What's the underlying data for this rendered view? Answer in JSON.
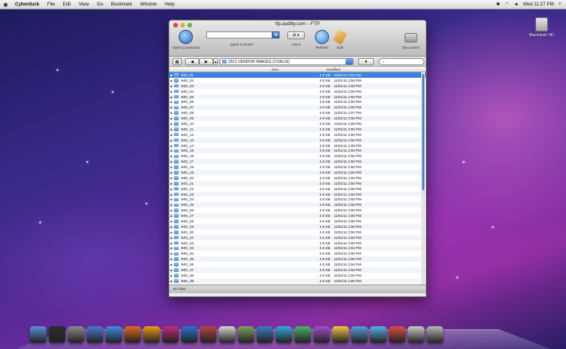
{
  "menubar": {
    "apple": "",
    "app_name": "Cyberduck",
    "items": [
      "File",
      "Edit",
      "View",
      "Go",
      "Bookmark",
      "Window",
      "Help"
    ],
    "clock": "Wed 11:27 PM"
  },
  "desktop": {
    "drive_label": "Macintosh HD"
  },
  "window": {
    "title": "ftp.auditly.com – FTP",
    "toolbar": {
      "open_connection": "Open Connection",
      "quick_connect": "Quick Connect",
      "action": "Action",
      "refresh": "Refresh",
      "edit": "Edit",
      "disconnect": "Disconnect"
    },
    "path": "2012 VENDOR IMAGES (COALIS)",
    "search_placeholder": "",
    "columns": {
      "size": "Size",
      "modified": "Modified"
    },
    "status": "51 Files"
  },
  "files": [
    {
      "name": "IMG_01",
      "size": "4.0 KB",
      "modified": "11/01/11 9:03 AM",
      "selected": true
    },
    {
      "name": "IMG_02",
      "size": "4.0 KB",
      "modified": "11/01/11 2:50 PM"
    },
    {
      "name": "IMG_03",
      "size": "4.0 KB",
      "modified": "11/01/11 2:50 PM"
    },
    {
      "name": "IMG_04",
      "size": "4.0 KB",
      "modified": "11/01/11 2:50 PM"
    },
    {
      "name": "IMG_05",
      "size": "4.0 KB",
      "modified": "11/01/11 2:50 PM"
    },
    {
      "name": "IMG_06",
      "size": "4.0 KB",
      "modified": "11/01/11 2:50 PM"
    },
    {
      "name": "IMG_07",
      "size": "4.0 KB",
      "modified": "11/01/11 2:50 PM"
    },
    {
      "name": "IMG_08",
      "size": "4.0 KB",
      "modified": "11/01/11 4:07 PM"
    },
    {
      "name": "IMG_09",
      "size": "4.0 KB",
      "modified": "11/01/11 2:50 PM"
    },
    {
      "name": "IMG_10",
      "size": "4.0 KB",
      "modified": "11/01/11 2:50 PM"
    },
    {
      "name": "IMG_11",
      "size": "4.0 KB",
      "modified": "11/01/11 2:50 PM"
    },
    {
      "name": "IMG_12",
      "size": "4.0 KB",
      "modified": "11/01/11 2:50 PM"
    },
    {
      "name": "IMG_13",
      "size": "4.0 KB",
      "modified": "11/01/11 2:50 PM"
    },
    {
      "name": "IMG_14",
      "size": "4.0 KB",
      "modified": "11/01/11 2:50 PM"
    },
    {
      "name": "IMG_15",
      "size": "4.0 KB",
      "modified": "11/01/11 2:50 PM"
    },
    {
      "name": "IMG_16",
      "size": "4.0 KB",
      "modified": "11/01/11 2:50 PM"
    },
    {
      "name": "IMG_17",
      "size": "4.0 KB",
      "modified": "11/01/11 2:50 PM"
    },
    {
      "name": "IMG_18",
      "size": "4.0 KB",
      "modified": "11/01/11 2:50 PM"
    },
    {
      "name": "IMG_19",
      "size": "4.0 KB",
      "modified": "11/01/11 2:50 PM"
    },
    {
      "name": "IMG_20",
      "size": "4.0 KB",
      "modified": "11/01/11 2:50 PM"
    },
    {
      "name": "IMG_21",
      "size": "4.0 KB",
      "modified": "11/01/11 2:50 PM"
    },
    {
      "name": "IMG_22",
      "size": "4.0 KB",
      "modified": "11/01/11 2:50 PM"
    },
    {
      "name": "IMG_23",
      "size": "4.0 KB",
      "modified": "11/01/11 2:50 PM"
    },
    {
      "name": "IMG_24",
      "size": "4.0 KB",
      "modified": "11/01/11 2:50 PM"
    },
    {
      "name": "IMG_25",
      "size": "4.0 KB",
      "modified": "11/01/11 2:50 PM"
    },
    {
      "name": "IMG_26",
      "size": "4.0 KB",
      "modified": "11/01/11 2:50 PM"
    },
    {
      "name": "IMG_27",
      "size": "4.0 KB",
      "modified": "11/01/11 2:50 PM"
    },
    {
      "name": "IMG_28",
      "size": "4.0 KB",
      "modified": "11/01/11 2:50 PM"
    },
    {
      "name": "IMG_29",
      "size": "4.0 KB",
      "modified": "11/01/11 2:50 PM"
    },
    {
      "name": "IMG_30",
      "size": "4.0 KB",
      "modified": "11/01/11 2:50 PM"
    },
    {
      "name": "IMG_31",
      "size": "4.0 KB",
      "modified": "11/01/11 2:50 PM"
    },
    {
      "name": "IMG_32",
      "size": "4.0 KB",
      "modified": "11/01/11 2:50 PM"
    },
    {
      "name": "IMG_33",
      "size": "4.0 KB",
      "modified": "11/01/11 2:50 PM"
    },
    {
      "name": "IMG_34",
      "size": "4.0 KB",
      "modified": "11/01/11 2:50 PM"
    },
    {
      "name": "IMG_35",
      "size": "4.0 KB",
      "modified": "11/01/11 2:50 PM"
    },
    {
      "name": "IMG_36",
      "size": "4.0 KB",
      "modified": "11/01/11 2:50 PM"
    },
    {
      "name": "IMG_37",
      "size": "4.0 KB",
      "modified": "11/01/11 2:50 PM"
    },
    {
      "name": "IMG_38",
      "size": "4.0 KB",
      "modified": "11/01/11 2:50 PM"
    },
    {
      "name": "IMG_39",
      "size": "4.0 KB",
      "modified": "11/01/11 2:50 PM"
    }
  ],
  "dock": {
    "apps": [
      {
        "name": "finder",
        "color": "#5a8fd6"
      },
      {
        "name": "dashboard",
        "color": "#2c2c2c"
      },
      {
        "name": "system-preferences",
        "color": "#8a8a8a"
      },
      {
        "name": "itunes",
        "color": "#4a7bd0"
      },
      {
        "name": "safari",
        "color": "#3f8fe0"
      },
      {
        "name": "firefox",
        "color": "#e06a1e"
      },
      {
        "name": "illustrator",
        "color": "#f09a17"
      },
      {
        "name": "indesign",
        "color": "#c22a7a"
      },
      {
        "name": "photoshop",
        "color": "#2a74c8"
      },
      {
        "name": "bridge",
        "color": "#b5453a"
      },
      {
        "name": "acrobat",
        "color": "#d5d5d5"
      },
      {
        "name": "iphoto",
        "color": "#7ba35a"
      },
      {
        "name": "isync",
        "color": "#3a7fbf"
      },
      {
        "name": "ichat",
        "color": "#37a6e0"
      },
      {
        "name": "dreamweaver",
        "color": "#4bb36a"
      },
      {
        "name": "fireworks",
        "color": "#a04fcf"
      },
      {
        "name": "cyberduck",
        "color": "#f4c542"
      },
      {
        "name": "network",
        "color": "#5b9ed9"
      },
      {
        "name": "messages",
        "color": "#5ab0e8"
      },
      {
        "name": "calendar",
        "color": "#e04a4a"
      },
      {
        "name": "stack",
        "color": "#c9c9c9"
      },
      {
        "name": "trash",
        "color": "#b5b5b5"
      }
    ]
  }
}
